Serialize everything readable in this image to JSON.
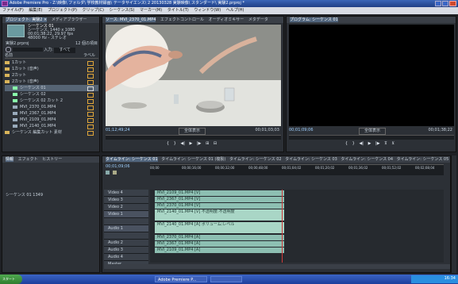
{
  "window": {
    "title": "Adobe Premiere Pro - Z:\\映像\\ フォルダ\\ 学校教材録画\\ テータサイエンス\\ 2 20130328 実験映像\\ スタンダード\\ 実験2.prproj *"
  },
  "menu": [
    "ファイル(F)",
    "編集(E)",
    "プロジェクト(P)",
    "クリップ(C)",
    "シーケンス(S)",
    "マーカー(M)",
    "タイトル(T)",
    "ウィンドウ(W)",
    "ヘルプ(H)"
  ],
  "project": {
    "tabs": [
      "プロジェクト: 実験2 ×",
      "メディアブラウザー"
    ],
    "clip_name": "シーケンス 01",
    "clip_details": [
      "シーケンス, 1440 x 1080",
      "00;01;38;22, 29.97 fps",
      "48000 Hz - ステレオ"
    ],
    "file_name": "実験2.prproj",
    "item_count": "12 個の項目",
    "search_label": "検索:",
    "in_label": "入力:",
    "in_value": "すべて",
    "col_name": "名前",
    "col_label": "ラベル",
    "items": [
      "1カット",
      "1カット (音声)",
      "2カット",
      "2カット (音声)",
      "シーケンス 01",
      "シーケンス 02",
      "シーケンス 02 カット 2",
      "MVI_2370_01.MP4",
      "MVI_2367_01.MP4",
      "MVI_2109_01.MP4",
      "MVI_2140_01.MP4",
      "シーケンス 編集カット 素材"
    ]
  },
  "source": {
    "tabs": [
      "ソース: MVI_2370_01.MP4",
      "エフェクトコントロール",
      "オーディオミキサー",
      "メタデータ"
    ],
    "timecode_left": "01;12;49;24",
    "fit": "全体表示",
    "timecode_right": "00;01;03;03"
  },
  "program": {
    "tabs": [
      "プログラム: シーケンス 01"
    ],
    "timecode_left": "00;01;09;06",
    "fit": "全体表示",
    "timecode_right": "00;01;38;22"
  },
  "info": {
    "tabs": [
      "情報",
      "エフェクト",
      "ヒストリー"
    ],
    "line": "シーケンス 01 1349"
  },
  "timeline": {
    "tabs": [
      "タイムライン: シーケンス 01",
      "タイムライン: シーケンス 01 (複製)",
      "タイムライン: シーケンス 02",
      "タイムライン: シーケンス 03",
      "タイムライン: シーケンス 04",
      "タイムライン: シーケンス 05"
    ],
    "timecode": "00;01;09;06",
    "ruler_marks": [
      "00;00",
      "00;00;16;00",
      "00;00;32;00",
      "00;00;48;00",
      "00;01;04;02",
      "00;01;20;02",
      "00;01;36;02",
      "00;01;52;02",
      "00;02;08;04"
    ],
    "tracks": [
      "Video 4",
      "Video 3",
      "Video 2",
      "Video 1",
      "",
      "Audio 1",
      "",
      "Audio 2",
      "Audio 3",
      "Audio 4",
      "Master"
    ],
    "clips": {
      "v4": "MVI_2109_01.MP4 [V]",
      "v3": "MVI_2367_01.MP4 [V]",
      "v2": "MVI_2370_01.MP4 [V]",
      "v1": "MVI_2140_01.MP4 [V] 不透明度:不透明度",
      "a1": "MVI_2140_01.MP4 [A] ボリューム:レベル",
      "a2": "MVI_2370_01.MP4 [A]",
      "a3": "MVI_2367_01.MP4 [A]",
      "a4": "MVI_2109_01.MP4 [A]"
    }
  },
  "taskbar": {
    "start": "スタート",
    "tasks": [
      "Adobe Premiere P...",
      ""
    ],
    "clock": "16:34"
  }
}
